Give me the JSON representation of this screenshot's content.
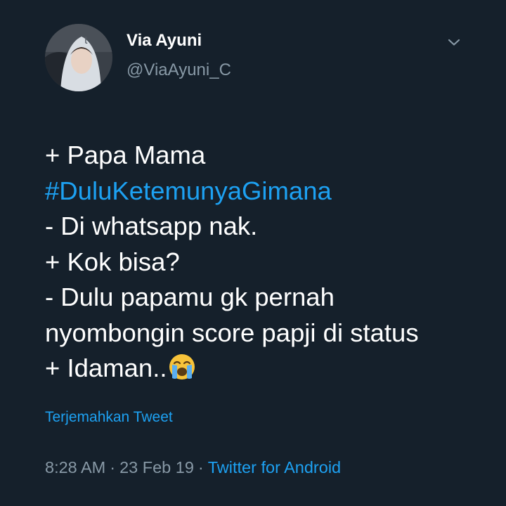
{
  "user": {
    "display_name": "Via Ayuni",
    "handle": "@ViaAyuni_C",
    "avatar_icon": "profile-photo",
    "menu_icon": "chevron-down-icon"
  },
  "tweet": {
    "lines": [
      "+ Papa Mama",
      "#DuluKetemunyaGimana",
      "- Di whatsapp nak.",
      "+ Kok bisa?",
      "- Dulu papamu gk pernah",
      "nyombongin score papji di status",
      "+ Idaman.."
    ],
    "emoji": "loudly-crying-face"
  },
  "translate_label": "Terjemahkan Tweet",
  "meta": {
    "time": "8:28 AM",
    "separator": "·",
    "date": "23 Feb 19",
    "source": "Twitter for Android"
  },
  "colors": {
    "background": "#15202b",
    "accent": "#1da1f2",
    "secondary_text": "#8899a6",
    "primary_text": "#ffffff"
  }
}
